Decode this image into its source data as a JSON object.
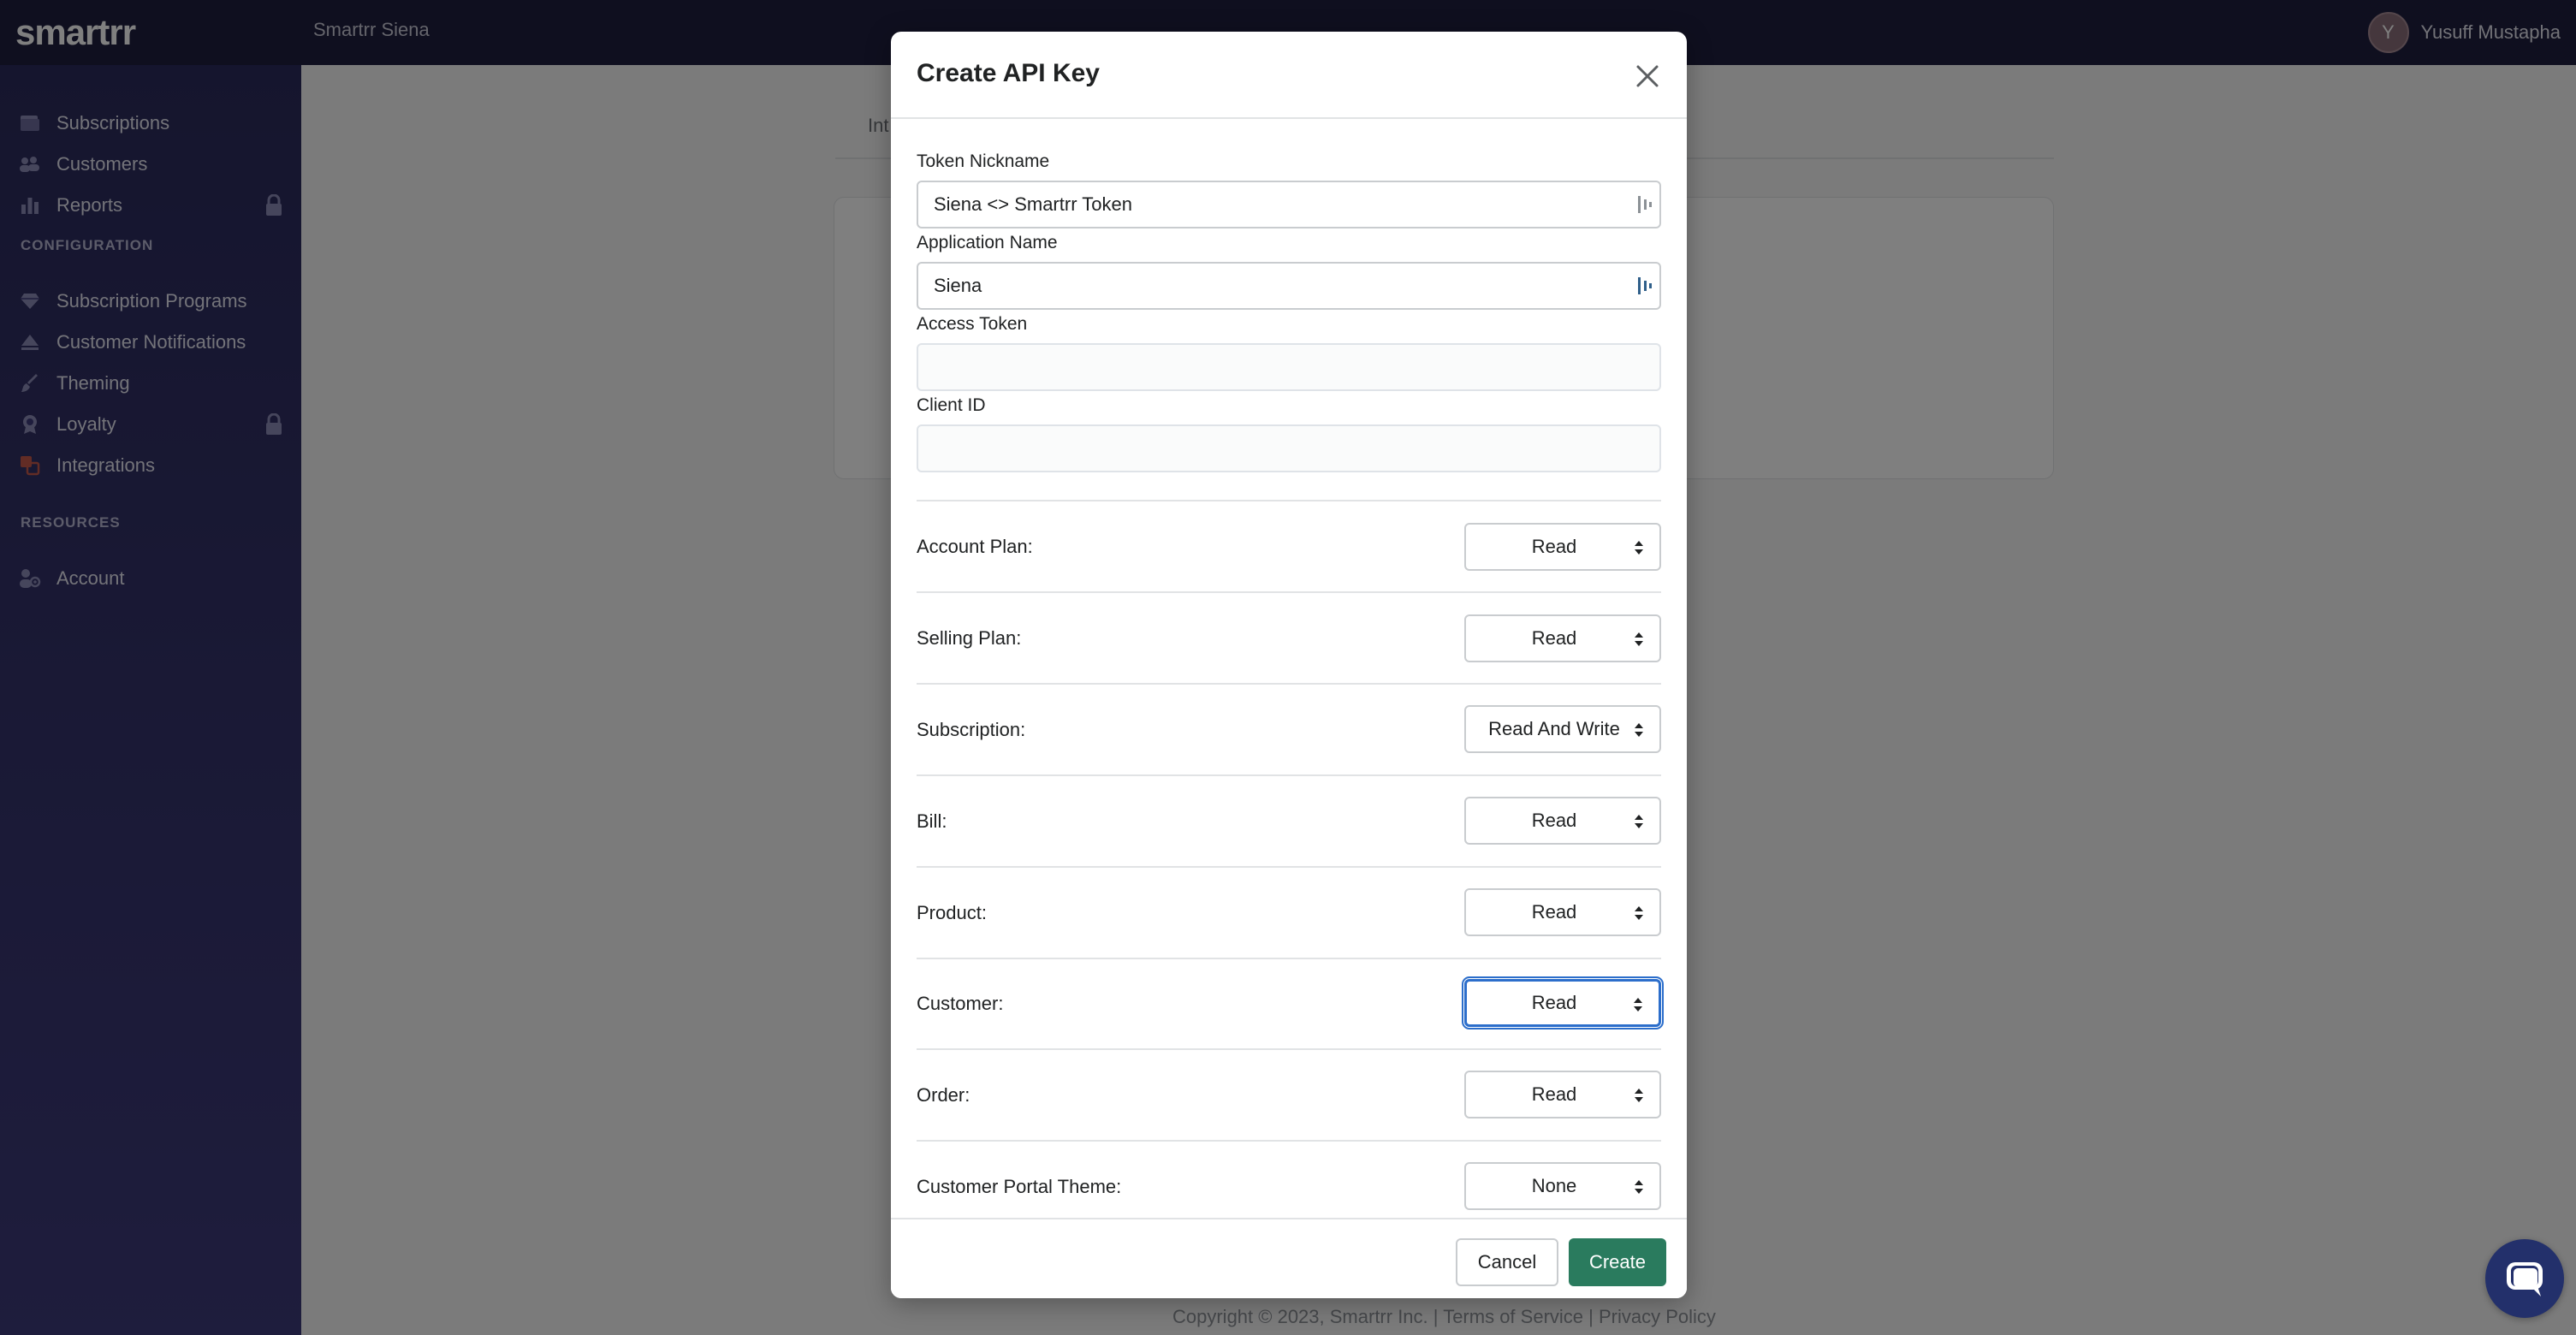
{
  "app": {
    "logo_text": "smartrr",
    "shop_name": "Smartrr Siena"
  },
  "user": {
    "initial": "Y",
    "name": "Yusuff Mustapha"
  },
  "sidebar": {
    "items": [
      {
        "label": "Subscriptions",
        "icon": "subscriptions-icon",
        "locked": false
      },
      {
        "label": "Customers",
        "icon": "customers-icon",
        "locked": false
      },
      {
        "label": "Reports",
        "icon": "reports-icon",
        "locked": true
      }
    ],
    "configuration_heading": "CONFIGURATION",
    "configuration_items": [
      {
        "label": "Subscription Programs",
        "icon": "diamond-icon",
        "locked": false
      },
      {
        "label": "Customer Notifications",
        "icon": "notifications-icon",
        "locked": false
      },
      {
        "label": "Theming",
        "icon": "brush-icon",
        "locked": false
      },
      {
        "label": "Loyalty",
        "icon": "loyalty-icon",
        "locked": true
      },
      {
        "label": "Integrations",
        "icon": "integrations-icon",
        "locked": false
      }
    ],
    "resources_heading": "RESOURCES",
    "resources_items": [
      {
        "label": "Account",
        "icon": "account-icon",
        "locked": false
      }
    ]
  },
  "background": {
    "tab_partial": "Int",
    "footer": "Copyright © 2023, Smartrr Inc. | Terms of Service | Privacy Policy"
  },
  "modal": {
    "title": "Create API Key",
    "fields": {
      "token_nickname": {
        "label": "Token Nickname",
        "value": "Siena <> Smartrr Token"
      },
      "application_name": {
        "label": "Application Name",
        "value": "Siena"
      },
      "access_token": {
        "label": "Access Token",
        "value": ""
      },
      "client_id": {
        "label": "Client ID",
        "value": ""
      }
    },
    "permissions": [
      {
        "label": "Account Plan:",
        "value": "Read"
      },
      {
        "label": "Selling Plan:",
        "value": "Read"
      },
      {
        "label": "Subscription:",
        "value": "Read And Write"
      },
      {
        "label": "Bill:",
        "value": "Read"
      },
      {
        "label": "Product:",
        "value": "Read"
      },
      {
        "label": "Customer:",
        "value": "Read",
        "focused": true
      },
      {
        "label": "Order:",
        "value": "Read"
      },
      {
        "label": "Customer Portal Theme:",
        "value": "None"
      }
    ],
    "cancel_label": "Cancel",
    "create_label": "Create"
  },
  "colors": {
    "topbar": "#1e1e3f",
    "sidebar": "#2b2b5c",
    "create_button": "#2a7b5e",
    "focus_ring": "#2c6ecb",
    "chat_bubble": "#23306b"
  }
}
